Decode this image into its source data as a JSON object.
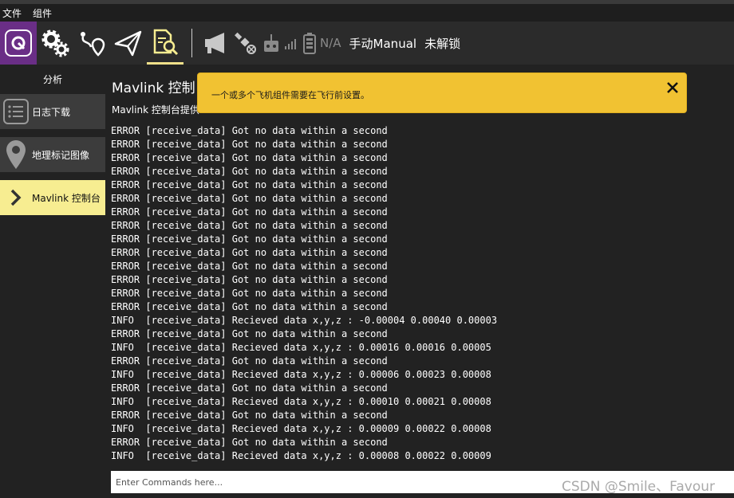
{
  "menubar": {
    "items": [
      "文件",
      "组件"
    ]
  },
  "toolbar": {
    "icons": [
      "app-logo-icon",
      "settings-gears-icon",
      "plan-route-icon",
      "fly-paper-plane-icon",
      "analyze-document-icon"
    ],
    "status_icons": [
      "megaphone-icon",
      "gps-satellite-icon",
      "rc-transmitter-icon",
      "signal-bars-icon",
      "battery-icon"
    ],
    "battery_label": "N/A",
    "flight_mode": "手动Manual",
    "arm_state": "未解锁"
  },
  "sidebar": {
    "title": "分析",
    "items": [
      {
        "label": "日志下载",
        "icon": "list-icon",
        "active": false
      },
      {
        "label": "地理标记图像",
        "icon": "map-pin-icon",
        "active": false
      },
      {
        "label": "Mavlink 控制台",
        "icon": "chevron-right-icon",
        "active": true
      }
    ]
  },
  "main": {
    "title": "Mavlink 控制",
    "description": "Mavlink 控制台提供"
  },
  "banner": {
    "message": "一个或多个飞机组件需要在飞行前设置。",
    "color": "#f1c232"
  },
  "console": {
    "lines": [
      "ERROR [receive_data] Got no data within a second",
      "ERROR [receive_data] Got no data within a second",
      "ERROR [receive_data] Got no data within a second",
      "ERROR [receive_data] Got no data within a second",
      "ERROR [receive_data] Got no data within a second",
      "ERROR [receive_data] Got no data within a second",
      "ERROR [receive_data] Got no data within a second",
      "ERROR [receive_data] Got no data within a second",
      "ERROR [receive_data] Got no data within a second",
      "ERROR [receive_data] Got no data within a second",
      "ERROR [receive_data] Got no data within a second",
      "ERROR [receive_data] Got no data within a second",
      "ERROR [receive_data] Got no data within a second",
      "ERROR [receive_data] Got no data within a second",
      "INFO  [receive_data] Recieved data x,y,z : -0.00004 0.00040 0.00003",
      "ERROR [receive_data] Got no data within a second",
      "INFO  [receive_data] Recieved data x,y,z : 0.00016 0.00016 0.00005",
      "ERROR [receive_data] Got no data within a second",
      "INFO  [receive_data] Recieved data x,y,z : 0.00006 0.00023 0.00008",
      "ERROR [receive_data] Got no data within a second",
      "INFO  [receive_data] Recieved data x,y,z : 0.00010 0.00021 0.00008",
      "ERROR [receive_data] Got no data within a second",
      "INFO  [receive_data] Recieved data x,y,z : 0.00009 0.00022 0.00008",
      "ERROR [receive_data] Got no data within a second",
      "INFO  [receive_data] Recieved data x,y,z : 0.00008 0.00022 0.00009"
    ]
  },
  "command": {
    "placeholder": "Enter Commands here..."
  },
  "watermark": "CSDN @Smile、Favour",
  "colors": {
    "accent": "#f7ed91",
    "logo_bg": "#6a2e86",
    "banner": "#f1c232",
    "background": "#222222"
  }
}
